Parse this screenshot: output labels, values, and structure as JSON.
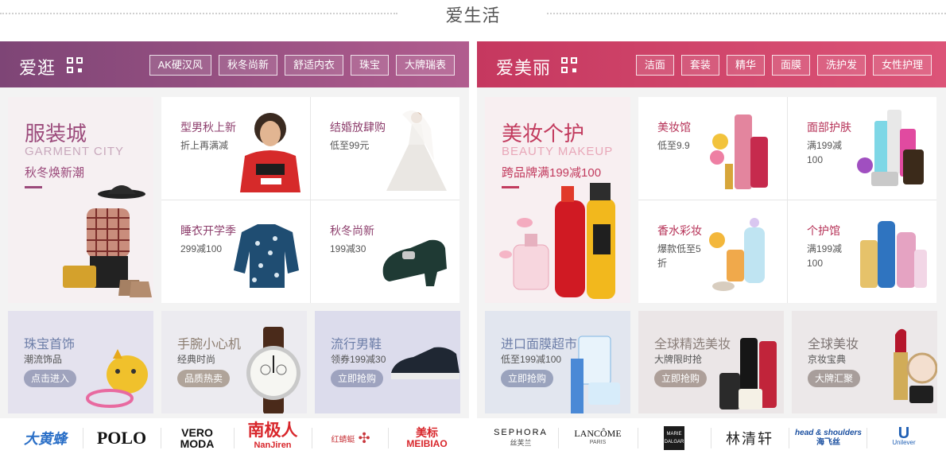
{
  "section": {
    "title": "爱生活"
  },
  "left": {
    "name": "爱逛",
    "tags": [
      "AK硬汉风",
      "秋冬尚新",
      "舒适内衣",
      "珠宝",
      "大牌瑞表"
    ],
    "hero": {
      "title": "服装城",
      "en": "GARMENT CITY",
      "sub": "秋冬焕新潮"
    },
    "cells": [
      {
        "title": "型男秋上新",
        "sub": "折上再满减"
      },
      {
        "title": "结婚放肆购",
        "sub": "低至99元"
      },
      {
        "title": "睡衣开学季",
        "sub": "299减100"
      },
      {
        "title": "秋冬尚新",
        "sub": "199减30"
      }
    ],
    "bottom": [
      {
        "title": "珠宝首饰",
        "sub": "潮流饰品",
        "btn": "点击进入"
      },
      {
        "title": "手腕小心机",
        "sub": "经典时尚",
        "btn": "品质热卖"
      },
      {
        "title": "流行男鞋",
        "sub": "领券199减30",
        "btn": "立即抢购"
      }
    ],
    "brands": [
      "大黄蜂",
      "POLO",
      "VERO MODA",
      "南极人",
      "红蜻蜓",
      "美标"
    ]
  },
  "right": {
    "name": "爱美丽",
    "tags": [
      "洁面",
      "套装",
      "精华",
      "面膜",
      "洗护发",
      "女性护理"
    ],
    "hero": {
      "title": "美妆个护",
      "en": "BEAUTY MAKEUP",
      "sub": "跨品牌满199减100"
    },
    "cells": [
      {
        "title": "美妆馆",
        "sub": "低至9.9"
      },
      {
        "title": "面部护肤",
        "sub": "满199减100"
      },
      {
        "title": "香水彩妆",
        "sub": "爆款低至5折"
      },
      {
        "title": "个护馆",
        "sub": "满199减100"
      }
    ],
    "bottom": [
      {
        "title": "进口面膜超市",
        "sub": "低至199减100",
        "btn": "立即抢购"
      },
      {
        "title": "全球精选美妆",
        "sub": "大牌限时抢",
        "btn": "立即抢购"
      },
      {
        "title": "全球美妆",
        "sub": "京妆宝典",
        "btn": "大牌汇聚"
      }
    ],
    "brands": [
      "SEPHORA",
      "LANCÔME",
      "MARIE DALGAR",
      "林清轩",
      "head & shoulders",
      "Unilever"
    ]
  },
  "brand_sub": {
    "sephora": "丝芙兰",
    "lancome": "PARIS",
    "nanjiren": "NanJiren",
    "meibiao": "MEIBIAO",
    "head": "海飞丝",
    "veromoda_a": "VERO",
    "veromoda_b": "MODA"
  }
}
